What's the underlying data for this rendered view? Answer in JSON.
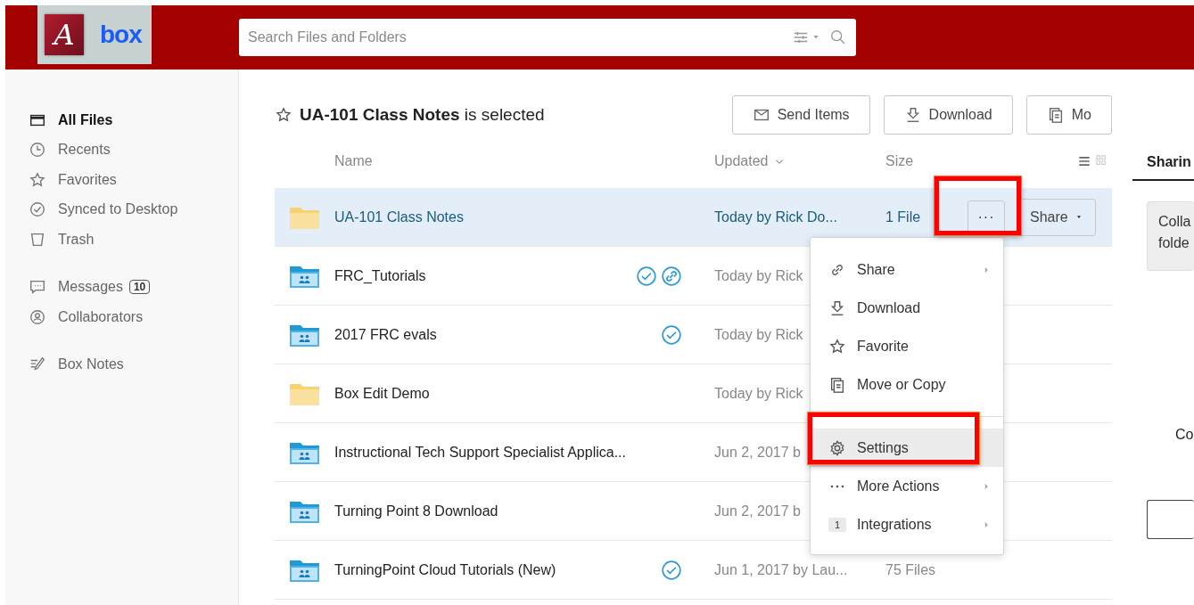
{
  "logo": {
    "mark": "A",
    "word": "box"
  },
  "search": {
    "placeholder": "Search Files and Folders"
  },
  "sidebar": {
    "groups": [
      [
        {
          "label": "All Files",
          "kind": "folder",
          "selected": true
        },
        {
          "label": "Recents",
          "kind": "clock",
          "selected": false
        },
        {
          "label": "Favorites",
          "kind": "star",
          "selected": false
        },
        {
          "label": "Synced to Desktop",
          "kind": "check",
          "selected": false
        },
        {
          "label": "Trash",
          "kind": "trash",
          "selected": false
        }
      ],
      [
        {
          "label": "Messages",
          "kind": "message",
          "selected": false,
          "badge": "10"
        },
        {
          "label": "Collaborators",
          "kind": "person",
          "selected": false
        }
      ],
      [
        {
          "label": "Box Notes",
          "kind": "note",
          "selected": false
        }
      ]
    ]
  },
  "title": "**UA-101 Class Notes** is selected",
  "toolbar": [
    {
      "label": "Send Items",
      "kind": "mail"
    },
    {
      "label": "Download",
      "kind": "download"
    },
    {
      "label": "Mo",
      "kind": "copy"
    }
  ],
  "table": {
    "columns": [
      "Name",
      "Updated",
      "Size"
    ],
    "rows": [
      {
        "kind": "folder",
        "name": "UA-101 Class Notes",
        "synced": false,
        "shared_link": false,
        "updated": "Today by Rick Do...",
        "size": "1 File",
        "selected": true,
        "actions": {
          "more": "···",
          "share": "Share",
          "highlighted": true
        }
      },
      {
        "kind": "shared-folder",
        "name": "FRC_Tutorials",
        "synced": true,
        "shared_link": true,
        "updated": "Today by Rick",
        "selected": false
      },
      {
        "kind": "shared-folder",
        "name": "2017 FRC evals",
        "synced": true,
        "shared_link": false,
        "updated": "Today by Rick",
        "selected": false
      },
      {
        "kind": "folder",
        "name": "Box Edit Demo",
        "synced": false,
        "shared_link": false,
        "updated": "Today by Rick",
        "selected": false
      },
      {
        "kind": "shared-folder",
        "name": "Instructional Tech Support Specialist Applica...",
        "synced": false,
        "shared_link": false,
        "updated": "Jun 2, 2017 b",
        "selected": false
      },
      {
        "kind": "shared-folder",
        "name": "Turning Point 8 Download",
        "synced": false,
        "shared_link": false,
        "updated": "Jun 2, 2017 b",
        "selected": false
      },
      {
        "kind": "shared-folder",
        "name": "TurningPoint Cloud Tutorials (New)",
        "synced": true,
        "shared_link": false,
        "updated": "Jun 1, 2017 by Lau...",
        "size": "75 Files",
        "selected": false
      }
    ]
  },
  "menu": {
    "items": [
      {
        "label": "Share",
        "kind": "link",
        "submenu": true,
        "highlighted": false
      },
      {
        "label": "Download",
        "kind": "download",
        "submenu": false,
        "highlighted": false
      },
      {
        "label": "Favorite",
        "kind": "star",
        "submenu": false,
        "highlighted": false
      },
      {
        "label": "Move or Copy",
        "kind": "copy",
        "submenu": false,
        "highlighted": false
      },
      {
        "label": "Settings",
        "kind": "gear",
        "submenu": false,
        "highlighted": true
      },
      {
        "label": "More Actions",
        "kind": "dots",
        "submenu": true,
        "highlighted": false
      },
      {
        "label": "Integrations",
        "kind": "count",
        "count": "1",
        "submenu": true,
        "highlighted": false
      }
    ]
  },
  "panel": {
    "tab": "Sharin",
    "notice": [
      "Colla",
      "folde"
    ],
    "label": "Co"
  }
}
